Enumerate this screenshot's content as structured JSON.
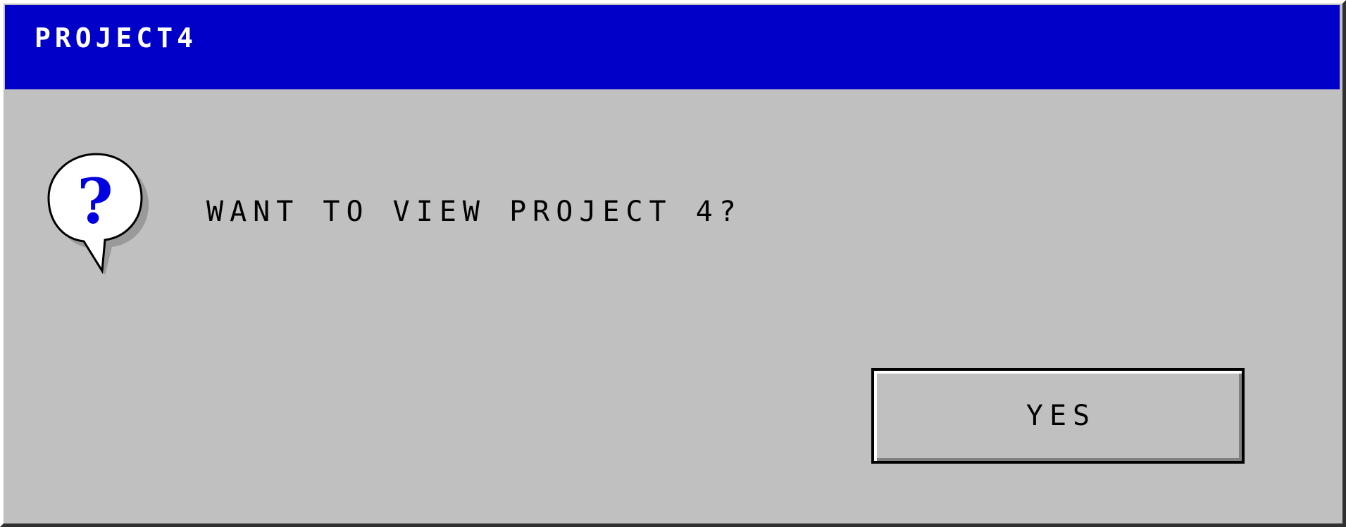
{
  "window": {
    "title": "PROJECT4",
    "titlebar_color": "#0000c8"
  },
  "dialog": {
    "icon": "question-icon",
    "message": "WANT TO VIEW PROJECT 4?",
    "yes_label": "YES"
  }
}
